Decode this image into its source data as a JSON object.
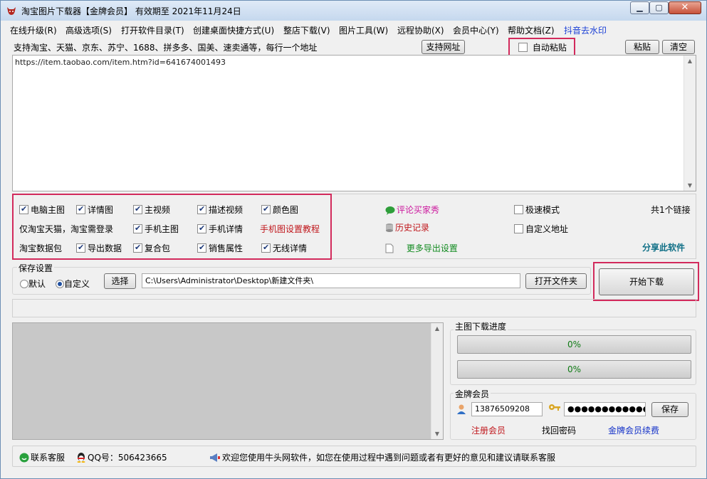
{
  "window": {
    "title": "淘宝图片下载器【金牌会员】 有效期至 2021年11月24日",
    "minimize_icon": "minimize-icon",
    "maximize_icon": "maximize-icon",
    "close_icon": "close-icon"
  },
  "menu": {
    "items": [
      {
        "label": "在线升级(R)"
      },
      {
        "label": "高级选项(S)"
      },
      {
        "label": "打开软件目录(T)"
      },
      {
        "label": "创建桌面快捷方式(U)"
      },
      {
        "label": "整店下载(V)"
      },
      {
        "label": "图片工具(W)"
      },
      {
        "label": "远程协助(X)"
      },
      {
        "label": "会员中心(Y)"
      },
      {
        "label": "帮助文档(Z)"
      },
      {
        "label": "抖音去水印"
      }
    ]
  },
  "input_section": {
    "support_text": "支持淘宝、天猫、京东、苏宁、1688、拼多多、国美、速卖通等，每行一个地址",
    "support_button": "支持网址",
    "auto_paste_label": "自动粘贴",
    "auto_paste_checked": false,
    "paste_button": "粘贴",
    "clear_button": "清空",
    "url_value": "https://item.taobao.com/item.htm?id=641674001493"
  },
  "options": {
    "pc_main_image": {
      "label": "电脑主图",
      "checked": true
    },
    "detail_image": {
      "label": "详情图",
      "checked": true
    },
    "main_video": {
      "label": "主视频",
      "checked": true
    },
    "desc_video": {
      "label": "描述视频",
      "checked": true
    },
    "color_image": {
      "label": "颜色图",
      "checked": true
    },
    "taobao_login_note": "仅淘宝天猫，淘宝需登录",
    "mobile_main_image": {
      "label": "手机主图",
      "checked": true
    },
    "mobile_detail": {
      "label": "手机详情",
      "checked": true
    },
    "mobile_tutorial_link": "手机图设置教程",
    "taobao_data_pack": "淘宝数据包",
    "export_data": {
      "label": "导出数据",
      "checked": true
    },
    "composite_pack": {
      "label": "复合包",
      "checked": true
    },
    "sales_attributes": {
      "label": "销售属性",
      "checked": true
    },
    "wireless_detail": {
      "label": "无线详情",
      "checked": true
    },
    "review_link": "评论买家秀",
    "history_link": "历史记录",
    "more_export_link": "更多导出设置",
    "fast_mode": {
      "label": "极速模式",
      "checked": false
    },
    "custom_address": {
      "label": "自定义地址",
      "checked": false
    },
    "link_count": "共1个链接",
    "share_link": "分享此软件"
  },
  "save_settings": {
    "group_label": "保存设置",
    "radio_default": "默认",
    "radio_custom": "自定义",
    "selected": "custom",
    "choose_button": "选择",
    "path_value": "C:\\Users\\Administrator\\Desktop\\新建文件夹\\",
    "open_folder_button": "打开文件夹",
    "start_download_button": "开始下载"
  },
  "progress_section": {
    "group_label": "主图下载进度",
    "bar1_text": "0%",
    "bar1_value": 0,
    "bar2_text": "0%",
    "bar2_value": 0
  },
  "member_section": {
    "group_label": "金牌会员",
    "account_value": "13876509208",
    "password_value": "●●●●●●●●●●●●●●",
    "save_button": "保存",
    "register_link": "注册会员",
    "recover_link": "找回密码",
    "renew_link": "金牌会员续费"
  },
  "footer": {
    "contact_service": "联系客服",
    "qq_number": "QQ号：506423665",
    "welcome_text": "欢迎您使用牛头网软件，如您在使用过程中遇到问题或者有更好的意见和建议请联系客服"
  },
  "colors": {
    "highlight_box": "#d22a5c",
    "menu_accent": "#1a3fd6",
    "link_red": "#c0161b",
    "link_magenta": "#cc1a9e",
    "link_green": "#118a1f",
    "link_teal": "#0f6f86",
    "link_blue": "#1230c8"
  }
}
